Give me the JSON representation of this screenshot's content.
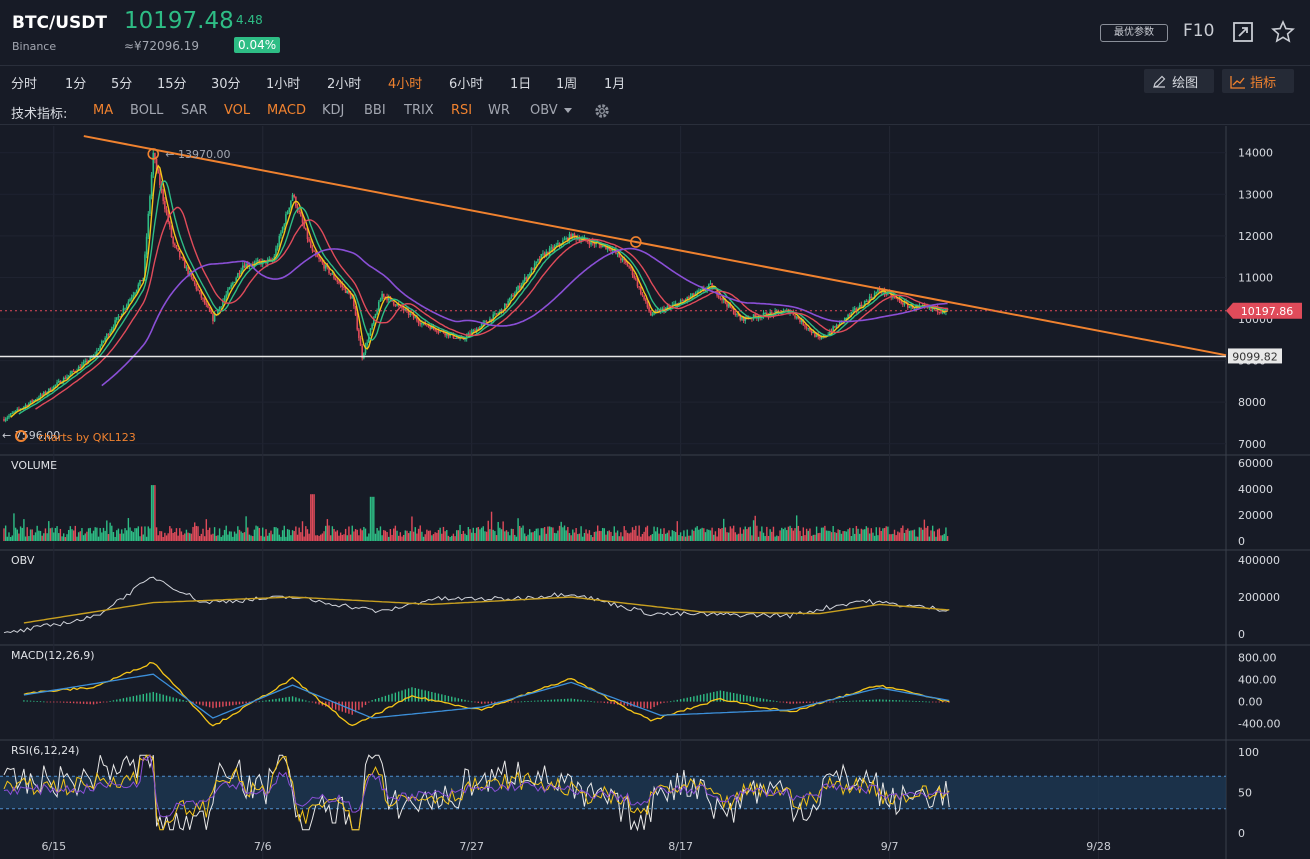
{
  "header": {
    "pair": "BTC/USDT",
    "exchange": "Binance",
    "price": "10197.48",
    "change": "4.48",
    "change_pct": "0.04%",
    "cny_price": "≈¥72096.19",
    "best_params_label": "最优参数",
    "f10_label": "F10"
  },
  "periods": [
    "分时",
    "1分",
    "5分",
    "15分",
    "30分",
    "1小时",
    "2小时",
    "4小时",
    "6小时",
    "1日",
    "1周",
    "1月"
  ],
  "active_period": "4小时",
  "tools": {
    "draw_label": "绘图",
    "indicator_label": "指标"
  },
  "indicator_bar": {
    "title": "技术指标:",
    "items": [
      "MA",
      "BOLL",
      "SAR",
      "VOL",
      "MACD",
      "KDJ",
      "BBI",
      "TRIX",
      "RSI",
      "WR",
      "OBV"
    ],
    "active": [
      "MA",
      "VOL",
      "MACD",
      "RSI"
    ]
  },
  "colors": {
    "up": "#2ebd85",
    "down": "#e04b5a",
    "accent": "#f0822f",
    "ma_fast": "#f5c518",
    "ma_mid": "#2ebd85",
    "ma_slow": "#e04b5a",
    "ma_long": "#8a4fd6",
    "obv_line": "#d0d3da",
    "obv_ma": "#c8a020",
    "macd_dif": "#f5c518",
    "macd_dea": "#3c8fd9",
    "rsi6": "#e8e8e8",
    "rsi12": "#f5c518",
    "rsi24": "#8a4fd6"
  },
  "chart_data": [
    {
      "type": "candlestick",
      "panel": "price",
      "x_ticks": [
        "6/15",
        "7/6",
        "7/27",
        "8/17",
        "9/7",
        "9/28"
      ],
      "y_ticks": [
        14000,
        13000,
        12000,
        11000,
        10000,
        9000,
        8000,
        7000
      ],
      "ylim": [
        6850,
        14450
      ],
      "price_path": [
        [
          "2019-06-11",
          7596
        ],
        [
          "2019-06-15",
          8200
        ],
        [
          "2019-06-20",
          9100
        ],
        [
          "2019-06-25",
          11000
        ],
        [
          "2019-06-26",
          13970
        ],
        [
          "2019-06-28",
          11800
        ],
        [
          "2019-07-02",
          10000
        ],
        [
          "2019-07-05",
          11300
        ],
        [
          "2019-07-08",
          11400
        ],
        [
          "2019-07-10",
          13000
        ],
        [
          "2019-07-12",
          11600
        ],
        [
          "2019-07-16",
          10500
        ],
        [
          "2019-07-17",
          9100
        ],
        [
          "2019-07-19",
          10600
        ],
        [
          "2019-07-23",
          9900
        ],
        [
          "2019-07-27",
          9500
        ],
        [
          "2019-07-31",
          10200
        ],
        [
          "2019-08-04",
          11500
        ],
        [
          "2019-08-07",
          12000
        ],
        [
          "2019-08-11",
          11700
        ],
        [
          "2019-08-13",
          11200
        ],
        [
          "2019-08-15",
          10100
        ],
        [
          "2019-08-18",
          10400
        ],
        [
          "2019-08-21",
          10800
        ],
        [
          "2019-08-24",
          10000
        ],
        [
          "2019-08-29",
          10200
        ],
        [
          "2019-09-01",
          9500
        ],
        [
          "2019-09-05",
          10300
        ],
        [
          "2019-09-07",
          10700
        ],
        [
          "2019-09-10",
          10300
        ],
        [
          "2019-09-14",
          10197
        ]
      ],
      "annotations": {
        "high_label": "13970.00",
        "low_label": "7596.00",
        "last_price_label": "10197.86",
        "support_label": "9099.82",
        "watermark": "charts by QKL123"
      },
      "trendline": [
        [
          "2019-06-15",
          14400
        ],
        [
          "2019-09-30",
          9130
        ]
      ],
      "support_level": 9099.82,
      "last_price": 10197.86
    },
    {
      "type": "bar",
      "panel": "VOLUME",
      "title": "VOLUME",
      "y_ticks": [
        60000,
        40000,
        20000,
        0
      ],
      "ylim": [
        0,
        60000
      ],
      "peak_values": [
        [
          "2019-06-26",
          43000
        ],
        [
          "2019-07-12",
          36000
        ],
        [
          "2019-07-18",
          34000
        ]
      ]
    },
    {
      "type": "line",
      "panel": "OBV",
      "title": "OBV",
      "y_ticks": [
        400000,
        200000,
        0
      ],
      "ylim": [
        0,
        400000
      ],
      "series": [
        {
          "values": [
            [
              "2019-06-11",
              0
            ],
            [
              "2019-06-20",
              90000
            ],
            [
              "2019-06-26",
              310000
            ],
            [
              "2019-07-01",
              170000
            ],
            [
              "2019-07-10",
              200000
            ],
            [
              "2019-07-19",
              120000
            ],
            [
              "2019-07-24",
              190000
            ],
            [
              "2019-08-01",
              190000
            ],
            [
              "2019-08-07",
              220000
            ],
            [
              "2019-08-15",
              110000
            ],
            [
              "2019-08-29",
              100000
            ],
            [
              "2019-09-05",
              180000
            ],
            [
              "2019-09-14",
              130000
            ]
          ]
        },
        {
          "values": [
            [
              "2019-06-13",
              60000
            ],
            [
              "2019-06-26",
              170000
            ],
            [
              "2019-07-10",
              200000
            ],
            [
              "2019-07-24",
              160000
            ],
            [
              "2019-08-07",
              200000
            ],
            [
              "2019-08-20",
              120000
            ],
            [
              "2019-09-01",
              110000
            ],
            [
              "2019-09-07",
              160000
            ],
            [
              "2019-09-14",
              130000
            ]
          ]
        }
      ]
    },
    {
      "type": "line",
      "panel": "MACD",
      "title": "MACD(12,26,9)",
      "y_ticks": [
        "800.00",
        "400.00",
        "0.00",
        "-400.00"
      ],
      "ylim": [
        -500,
        850
      ],
      "series": [
        {
          "values": [
            [
              "2019-06-13",
              150
            ],
            [
              "2019-06-20",
              260
            ],
            [
              "2019-06-26",
              720
            ],
            [
              "2019-07-02",
              -450
            ],
            [
              "2019-07-08",
              200
            ],
            [
              "2019-07-10",
              420
            ],
            [
              "2019-07-16",
              -450
            ],
            [
              "2019-07-22",
              100
            ],
            [
              "2019-07-29",
              -150
            ],
            [
              "2019-08-07",
              420
            ],
            [
              "2019-08-15",
              -350
            ],
            [
              "2019-08-22",
              50
            ],
            [
              "2019-08-29",
              -200
            ],
            [
              "2019-09-07",
              300
            ],
            [
              "2019-09-14",
              0
            ]
          ]
        },
        {
          "values": [
            [
              "2019-06-13",
              120
            ],
            [
              "2019-06-26",
              500
            ],
            [
              "2019-07-02",
              -300
            ],
            [
              "2019-07-10",
              300
            ],
            [
              "2019-07-18",
              -300
            ],
            [
              "2019-07-29",
              -100
            ],
            [
              "2019-08-07",
              350
            ],
            [
              "2019-08-16",
              -250
            ],
            [
              "2019-08-29",
              -150
            ],
            [
              "2019-09-07",
              250
            ],
            [
              "2019-09-14",
              20
            ]
          ]
        }
      ]
    },
    {
      "type": "line",
      "panel": "RSI",
      "title": "RSI(6,12,24)",
      "y_ticks": [
        100,
        50,
        0
      ],
      "ylim": [
        0,
        100
      ],
      "bands": [
        30,
        70
      ]
    }
  ]
}
